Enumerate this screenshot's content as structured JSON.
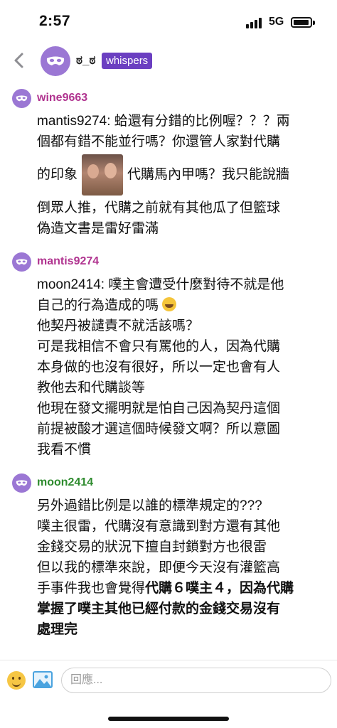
{
  "status_bar": {
    "time": "2:57",
    "network": "5G"
  },
  "header": {
    "name": "ಠ_ಠ",
    "badge": "whispers",
    "avatar_icon": "mask-icon"
  },
  "comments": [
    {
      "author": "wine9663",
      "author_color": "#b0338f",
      "avatar_icon": "mask-icon",
      "lines": [
        "mantis9274: 蛤還有分錯的比例喔？？？兩",
        "個都有錯不能並行嗎？你還管人家對代購"
      ],
      "inline_prefix": "的印象",
      "inline_suffix": "代購馬內甲嗎？我只能說牆",
      "tail": [
        "倒眾人推，代購之前就有其他瓜了但籃球",
        "偽造文書是雷好雷滿"
      ]
    },
    {
      "author": "mantis9274",
      "author_color": "#b0338f",
      "avatar_icon": "mask-icon",
      "lines": [
        "moon2414: 噗主會遭受什麼對待不就是他",
        "自己的行為造成的嗎",
        "他契丹被譴責不就活該嗎？",
        "可是我相信不會只有罵他的人，因為代購",
        "本身做的也沒有很好，所以一定也會有人",
        "教他去和代購談等",
        "他現在發文擺明就是怕自己因為契丹這個",
        "前提被酸才選這個時候發文啊？所以意圖",
        "我看不慣"
      ]
    },
    {
      "author": "moon2414",
      "author_color": "#2e8b2e",
      "avatar_icon": "mask-icon",
      "lines": [
        "另外過錯比例是以誰的標準規定的???",
        "噗主很雷，代購沒有意識到對方還有其他",
        "金錢交易的狀況下擅自封鎖對方也很雷",
        "但以我的標準來說，即便今天沒有灌籃高"
      ],
      "mixed_plain": "手事件我也會覺得",
      "mixed_bold": "代購６噗主４，因為代購",
      "bold_lines": [
        "掌握了噗主其他已經付款的金錢交易沒有",
        "處理完"
      ]
    }
  ],
  "input_bar": {
    "placeholder": "回應..."
  }
}
